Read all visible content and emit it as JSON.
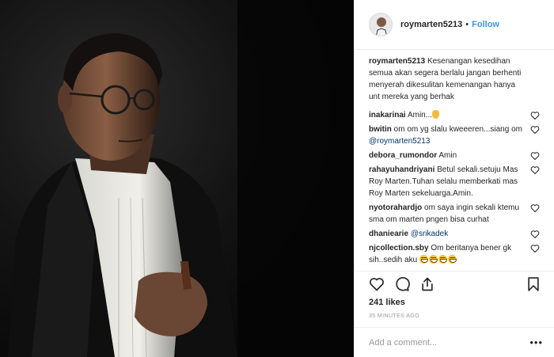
{
  "post": {
    "username": "roymarten5213",
    "separator": "•",
    "follow_label": "Follow"
  },
  "caption": {
    "username": "roymarten5213",
    "text": "Kesenangan kesedihan semua akan segera berlalu jangan berhenti menyerah dikesulitan kemenangan hanya unt mereka yang berhak"
  },
  "comments": [
    {
      "username": "inakarinai",
      "text": "Amin...",
      "emoji": "folded-hands"
    },
    {
      "username": "bwitin",
      "text": "om om yg slalu kweeeren...siang om ",
      "mention": "@roymarten5213"
    },
    {
      "username": "debora_rumondor",
      "text": "Amin"
    },
    {
      "username": "rahayuhandriyani",
      "text": "Betul sekali.setuju Mas Roy Marten.Tuhan selalu memberkati mas Roy Marten sekeluarga.Amin."
    },
    {
      "username": "nyotorahardjo",
      "text": "om saya ingin sekali ktemu sma om marten pngen bisa curhat"
    },
    {
      "username": "dhaniearie",
      "text": "",
      "mention": "@srikadek"
    },
    {
      "username": "njcollection.sby",
      "text": "Om beritanya bener gk sih..sedih aku ",
      "emoji": "crying-face x4"
    }
  ],
  "actions": {
    "like_icon": "heart-icon",
    "comment_icon": "comment-icon",
    "share_icon": "share-icon",
    "save_icon": "bookmark-icon"
  },
  "likes_label": "241 likes",
  "timestamp": "35 MINUTES AGO",
  "add_comment": {
    "placeholder": "Add a comment...",
    "more_label": "•••"
  },
  "colors": {
    "accent": "#3897f0",
    "mention": "#003569",
    "text": "#262626",
    "muted": "#999999"
  }
}
